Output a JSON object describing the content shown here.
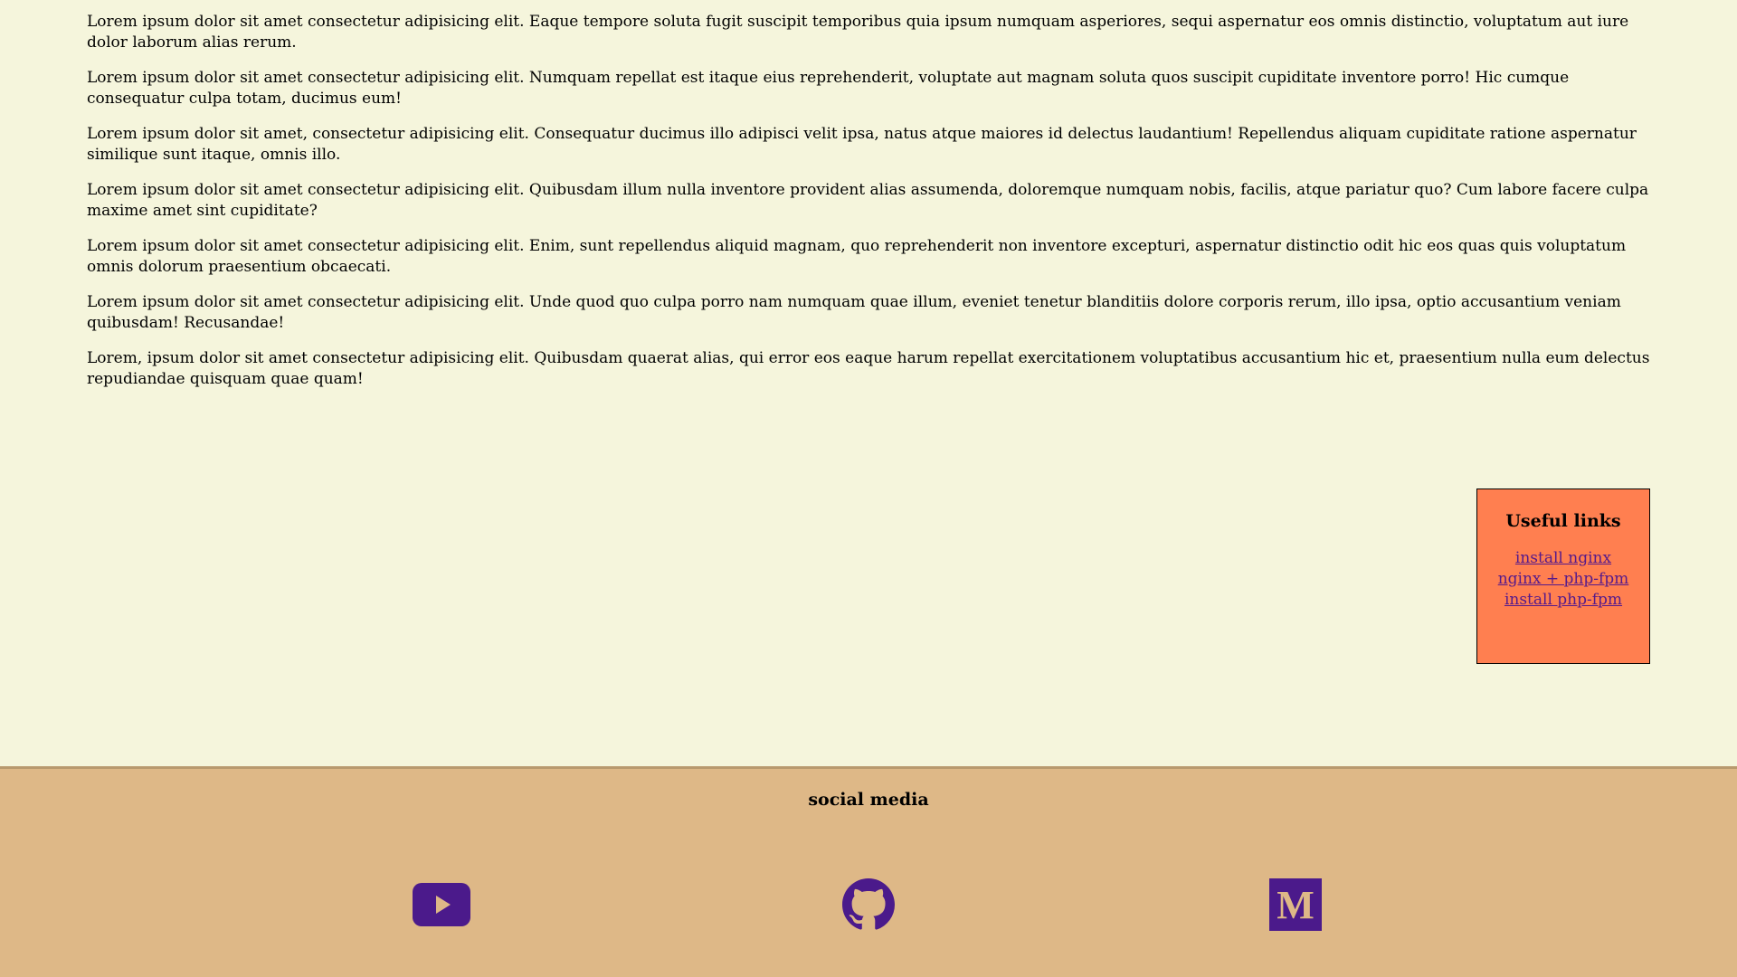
{
  "paragraphs": [
    "Lorem ipsum dolor sit amet consectetur adipisicing elit. Eaque tempore soluta fugit suscipit temporibus quia ipsum numquam asperiores, sequi aspernatur eos omnis distinctio, voluptatum aut iure dolor laborum alias rerum.",
    "Lorem ipsum dolor sit amet consectetur adipisicing elit. Numquam repellat est itaque eius reprehenderit, voluptate aut magnam soluta quos suscipit cupiditate inventore porro! Hic cumque consequatur culpa totam, ducimus eum!",
    "Lorem ipsum dolor sit amet, consectetur adipisicing elit. Consequatur ducimus illo adipisci velit ipsa, natus atque maiores id delectus laudantium! Repellendus aliquam cupiditate ratione aspernatur similique sunt itaque, omnis illo.",
    "Lorem ipsum dolor sit amet consectetur adipisicing elit. Quibusdam illum nulla inventore provident alias assumenda, doloremque numquam nobis, facilis, atque pariatur quo? Cum labore facere culpa maxime amet sint cupiditate?",
    "Lorem ipsum dolor sit amet consectetur adipisicing elit. Enim, sunt repellendus aliquid magnam, quo reprehenderit non inventore excepturi, aspernatur distinctio odit hic eos quas quis voluptatum omnis dolorum praesentium obcaecati.",
    "Lorem ipsum dolor sit amet consectetur adipisicing elit. Unde quod quo culpa porro nam numquam quae illum, eveniet tenetur blanditiis dolore corporis rerum, illo ipsa, optio accusantium veniam quibusdam! Recusandae!",
    "Lorem, ipsum dolor sit amet consectetur adipisicing elit. Quibusdam quaerat alias, qui error eos eaque harum repellat exercitationem voluptatibus accusantium hic et, praesentium nulla eum delectus repudiandae quisquam quae quam!"
  ],
  "useful_links": {
    "title": "Useful links",
    "links": [
      "install nginx",
      "nginx + php-fpm",
      "install php-fpm"
    ]
  },
  "footer": {
    "title": "social media",
    "icons": [
      "youtube-icon",
      "github-icon",
      "medium-icon"
    ]
  },
  "colors": {
    "background": "#f5f5dc",
    "sidebar_box": "#ff7f50",
    "footer": "#deb887",
    "link": "#551a8b",
    "icon": "#4b1a8b"
  }
}
